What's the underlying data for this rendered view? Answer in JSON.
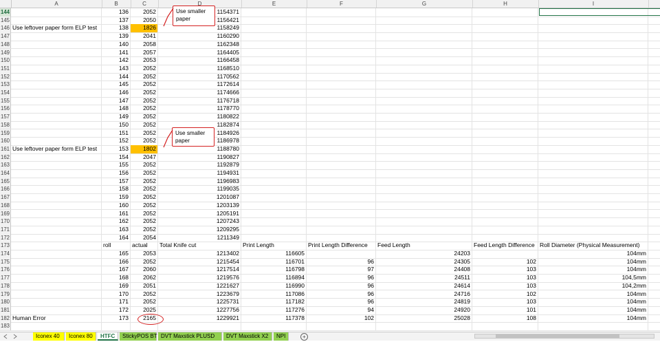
{
  "columns": [
    "A",
    "B",
    "C",
    "D",
    "E",
    "F",
    "G",
    "H",
    "I"
  ],
  "rows": [
    {
      "n": "144",
      "a": "",
      "b": "136",
      "c": "2052",
      "d": "1154371",
      "sel": true
    },
    {
      "n": "145",
      "a": "",
      "b": "137",
      "c": "2050",
      "d": "1156421"
    },
    {
      "n": "146",
      "a": "Use leftover paper form  ELP test",
      "b": "138",
      "c": "1826",
      "d": "1158249",
      "hl": true
    },
    {
      "n": "147",
      "a": "",
      "b": "139",
      "c": "2041",
      "d": "1160290"
    },
    {
      "n": "148",
      "a": "",
      "b": "140",
      "c": "2058",
      "d": "1162348"
    },
    {
      "n": "149",
      "a": "",
      "b": "141",
      "c": "2057",
      "d": "1164405"
    },
    {
      "n": "150",
      "a": "",
      "b": "142",
      "c": "2053",
      "d": "1166458"
    },
    {
      "n": "151",
      "a": "",
      "b": "143",
      "c": "2052",
      "d": "1168510"
    },
    {
      "n": "152",
      "a": "",
      "b": "144",
      "c": "2052",
      "d": "1170562"
    },
    {
      "n": "153",
      "a": "",
      "b": "145",
      "c": "2052",
      "d": "1172614"
    },
    {
      "n": "154",
      "a": "",
      "b": "146",
      "c": "2052",
      "d": "1174666"
    },
    {
      "n": "155",
      "a": "",
      "b": "147",
      "c": "2052",
      "d": "1176718"
    },
    {
      "n": "156",
      "a": "",
      "b": "148",
      "c": "2052",
      "d": "1178770"
    },
    {
      "n": "157",
      "a": "",
      "b": "149",
      "c": "2052",
      "d": "1180822"
    },
    {
      "n": "158",
      "a": "",
      "b": "150",
      "c": "2052",
      "d": "1182874"
    },
    {
      "n": "159",
      "a": "",
      "b": "151",
      "c": "2052",
      "d": "1184926"
    },
    {
      "n": "160",
      "a": "",
      "b": "152",
      "c": "2052",
      "d": "1186978"
    },
    {
      "n": "161",
      "a": "Use leftover paper form  ELP test",
      "b": "153",
      "c": "1802",
      "d": "1188780",
      "hl": true
    },
    {
      "n": "162",
      "a": "",
      "b": "154",
      "c": "2047",
      "d": "1190827"
    },
    {
      "n": "163",
      "a": "",
      "b": "155",
      "c": "2052",
      "d": "1192879"
    },
    {
      "n": "164",
      "a": "",
      "b": "156",
      "c": "2052",
      "d": "1194931"
    },
    {
      "n": "165",
      "a": "",
      "b": "157",
      "c": "2052",
      "d": "1196983"
    },
    {
      "n": "166",
      "a": "",
      "b": "158",
      "c": "2052",
      "d": "1199035"
    },
    {
      "n": "167",
      "a": "",
      "b": "159",
      "c": "2052",
      "d": "1201087"
    },
    {
      "n": "168",
      "a": "",
      "b": "160",
      "c": "2052",
      "d": "1203139"
    },
    {
      "n": "169",
      "a": "",
      "b": "161",
      "c": "2052",
      "d": "1205191"
    },
    {
      "n": "170",
      "a": "",
      "b": "162",
      "c": "2052",
      "d": "1207243"
    },
    {
      "n": "171",
      "a": "",
      "b": "163",
      "c": "2052",
      "d": "1209295"
    },
    {
      "n": "172",
      "a": "",
      "b": "164",
      "c": "2054",
      "d": "1211349"
    },
    {
      "n": "173",
      "a": "",
      "b": "roll",
      "c": "actual",
      "d": "Total Knife cut",
      "e": "Print Length",
      "f": "Print Length Difference",
      "g": "Feed Length",
      "h": "Feed Length Difference",
      "i": "Roll Diameter (Physical Measurement)",
      "header": true
    },
    {
      "n": "174",
      "a": "",
      "b": "165",
      "c": "2053",
      "d": "1213402",
      "e": "116605",
      "f": "",
      "g": "24203",
      "h": "",
      "i": "104mm"
    },
    {
      "n": "175",
      "a": "",
      "b": "166",
      "c": "2052",
      "d": "1215454",
      "e": "116701",
      "f": "96",
      "g": "24305",
      "h": "102",
      "i": "104mm"
    },
    {
      "n": "176",
      "a": "",
      "b": "167",
      "c": "2060",
      "d": "1217514",
      "e": "116798",
      "f": "97",
      "g": "24408",
      "h": "103",
      "i": "104mm"
    },
    {
      "n": "177",
      "a": "",
      "b": "168",
      "c": "2062",
      "d": "1219576",
      "e": "116894",
      "f": "96",
      "g": "24511",
      "h": "103",
      "i": "104,5mm"
    },
    {
      "n": "178",
      "a": "",
      "b": "169",
      "c": "2051",
      "d": "1221627",
      "e": "116990",
      "f": "96",
      "g": "24614",
      "h": "103",
      "i": "104,2mm"
    },
    {
      "n": "179",
      "a": "",
      "b": "170",
      "c": "2052",
      "d": "1223679",
      "e": "117086",
      "f": "96",
      "g": "24716",
      "h": "102",
      "i": "104mm"
    },
    {
      "n": "180",
      "a": "",
      "b": "171",
      "c": "2052",
      "d": "1225731",
      "e": "117182",
      "f": "96",
      "g": "24819",
      "h": "103",
      "i": "104mm"
    },
    {
      "n": "181",
      "a": "",
      "b": "172",
      "c": "2025",
      "d": "1227756",
      "e": "117276",
      "f": "94",
      "g": "24920",
      "h": "101",
      "i": "104mm"
    },
    {
      "n": "182",
      "a": "Human Error",
      "b": "173",
      "c": "2165",
      "d": "1229921",
      "e": "117378",
      "f": "102",
      "g": "25028",
      "h": "108",
      "i": "104mm"
    },
    {
      "n": "183",
      "a": "",
      "b": "",
      "c": "",
      "d": ""
    }
  ],
  "callouts": [
    "Use smaller paper",
    "Use smaller paper"
  ],
  "tabs": [
    {
      "label": "Iconex 40",
      "style": "y"
    },
    {
      "label": "Iconex 80",
      "style": "y"
    },
    {
      "label": "HTFC",
      "style": "active"
    },
    {
      "label": "StickyPOS BT",
      "style": "g"
    },
    {
      "label": "DVT Maxstick PLUSD",
      "style": "g"
    },
    {
      "label": "DVT Maxstick X2",
      "style": "g"
    },
    {
      "label": "NPI",
      "style": "g"
    }
  ],
  "colors": {
    "highlight": "#ffc000",
    "accent": "#217346",
    "annotation": "#d42020",
    "tab_yellow": "#ffff00",
    "tab_green": "#92d050"
  }
}
